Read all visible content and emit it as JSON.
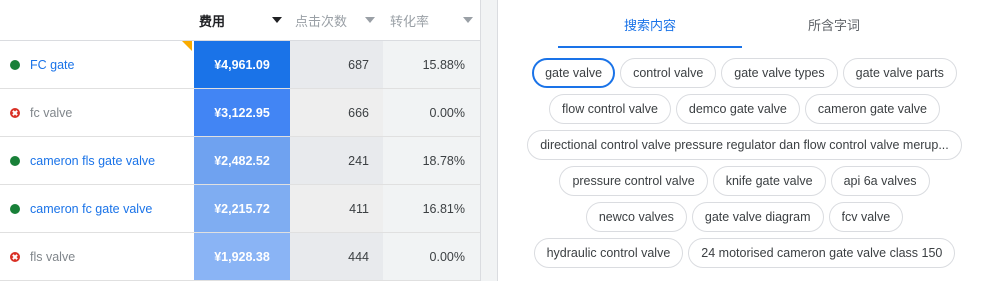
{
  "table": {
    "headers": {
      "cost": "费用",
      "clicks": "点击次数",
      "conversion": "转化率"
    },
    "rows": [
      {
        "keyword": "FC gate",
        "status": "active",
        "cost": "¥4,961.09",
        "cost_color": "#1a73e8",
        "clicks": "687",
        "conversion": "15.88%"
      },
      {
        "keyword": "fc valve",
        "status": "paused",
        "cost": "¥3,122.95",
        "cost_color": "#4285f4",
        "clicks": "666",
        "conversion": "0.00%"
      },
      {
        "keyword": "cameron fls gate valve",
        "status": "active",
        "cost": "¥2,482.52",
        "cost_color": "#6fa2f0",
        "clicks": "241",
        "conversion": "18.78%"
      },
      {
        "keyword": "cameron fc gate valve",
        "status": "active",
        "cost": "¥2,215.72",
        "cost_color": "#7fadf2",
        "clicks": "411",
        "conversion": "16.81%"
      },
      {
        "keyword": "fls valve",
        "status": "paused",
        "cost": "¥1,928.38",
        "cost_color": "#8ab4f5",
        "clicks": "444",
        "conversion": "0.00%"
      }
    ]
  },
  "panel": {
    "tabs": [
      "搜索内容",
      "所含字词"
    ],
    "active_tab": 0,
    "chips": [
      [
        "gate valve",
        "control valve",
        "gate valve types",
        "gate valve parts"
      ],
      [
        "flow control valve",
        "demco gate valve",
        "cameron gate valve"
      ],
      [
        "directional control valve pressure regulator dan flow control valve merup..."
      ],
      [
        "pressure control valve",
        "knife gate valve",
        "api 6a valves"
      ],
      [
        "newco valves",
        "gate valve diagram",
        "fcv valve"
      ],
      [
        "hydraulic control valve",
        "24 motorised cameron gate valve class 150"
      ]
    ],
    "selected_chip": "gate valve"
  },
  "colors": {
    "accent": "#1a73e8",
    "active_status": "#188038",
    "paused_status": "#d93025"
  }
}
